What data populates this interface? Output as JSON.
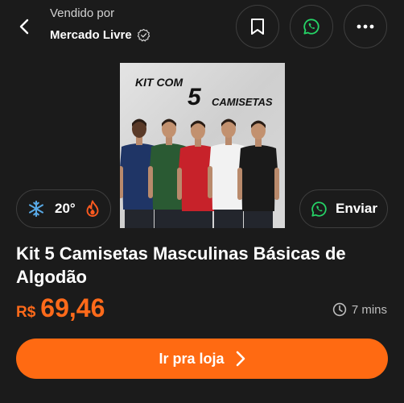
{
  "header": {
    "sold_by_label": "Vendido por",
    "seller_name": "Mercado Livre",
    "icons": [
      "back-arrow-icon",
      "verified-icon",
      "bookmark-icon",
      "whatsapp-icon",
      "more-icon"
    ]
  },
  "product": {
    "image_text_line1": "KIT COM",
    "image_text_number": "5",
    "image_text_line2": "CAMISETAS",
    "shirt_colors": [
      "#1f3566",
      "#2a5a33",
      "#c7222a",
      "#f2f2f2",
      "#1a1a1a"
    ],
    "title": "Kit 5 Camisetas Masculinas Básicas de Algodão",
    "currency": "R$",
    "price": "69,46"
  },
  "temperature": {
    "value": "20°",
    "icons": [
      "snowflake-icon",
      "flame-icon"
    ]
  },
  "share": {
    "label": "Enviar",
    "icon": "whatsapp-icon"
  },
  "posted": {
    "time": "7 mins",
    "icon": "clock-icon"
  },
  "cta": {
    "label": "Ir pra loja",
    "icon": "chevron-right-icon"
  },
  "colors": {
    "accent": "#ff6a12",
    "whatsapp": "#25d366",
    "cold": "#58a9e6",
    "background": "#1b1b1b"
  }
}
